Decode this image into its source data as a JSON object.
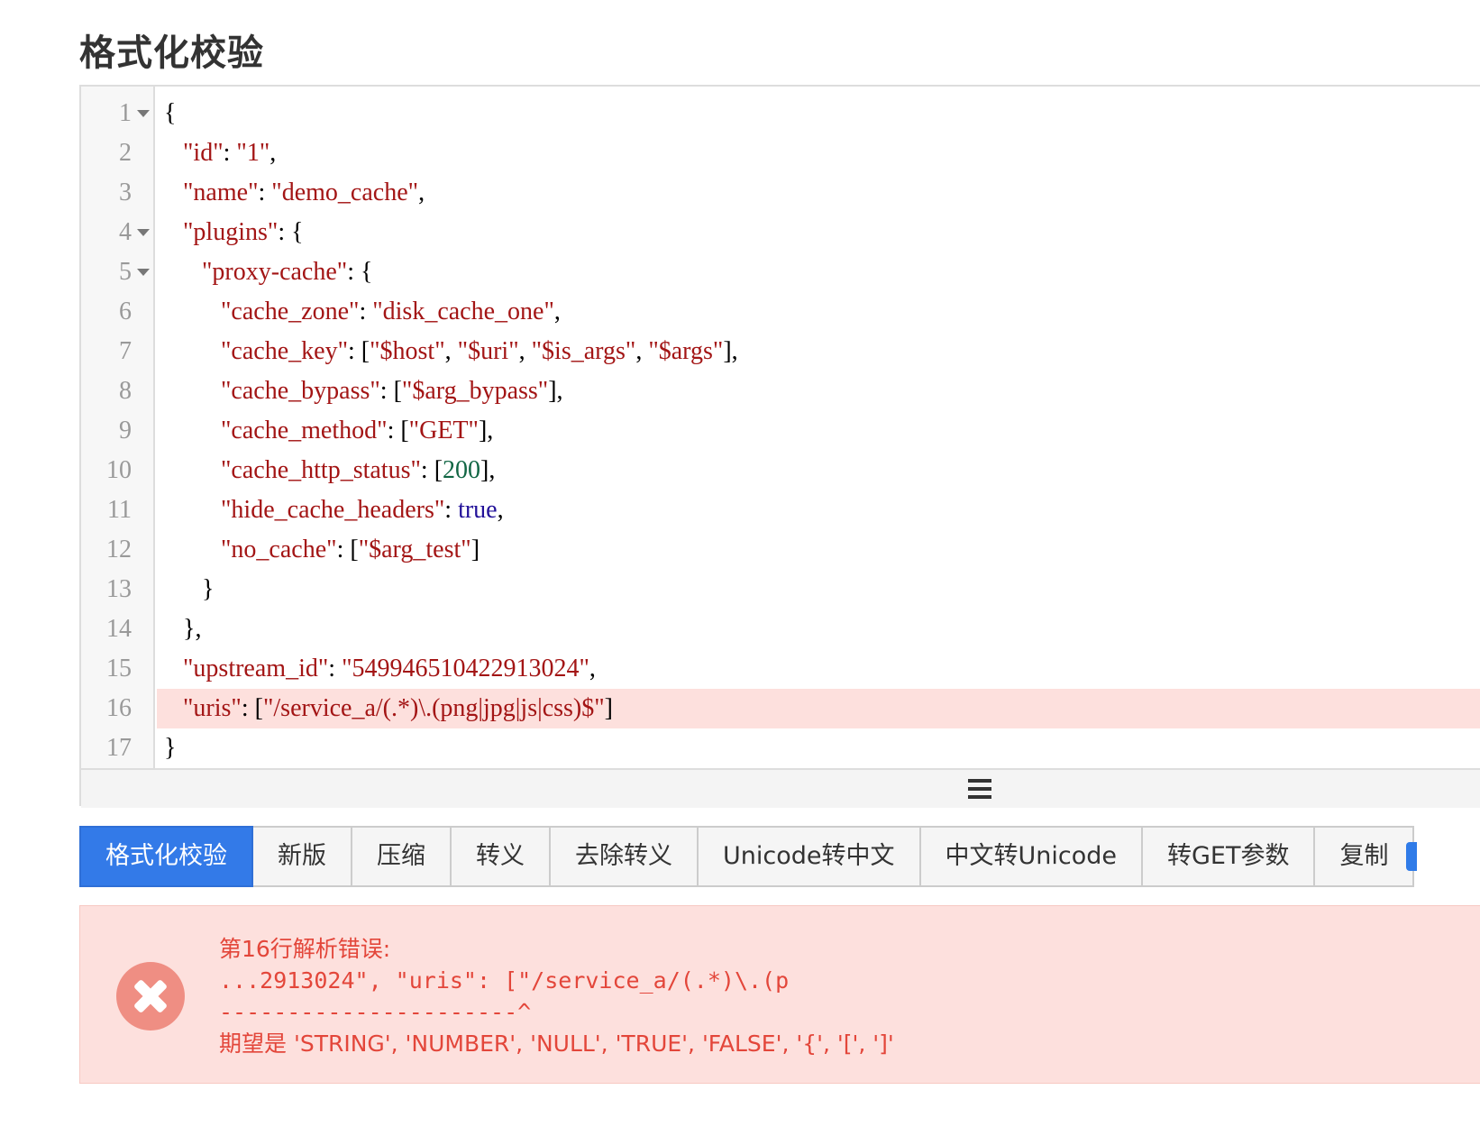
{
  "page_title": "格式化校验",
  "editor": {
    "gutter": {
      "line_numbers": [
        "1",
        "2",
        "3",
        "4",
        "5",
        "6",
        "7",
        "8",
        "9",
        "10",
        "11",
        "12",
        "13",
        "14",
        "15",
        "16",
        "17"
      ],
      "fold_lines": [
        "1",
        "4",
        "5"
      ]
    },
    "error_line": "16",
    "lines": [
      [
        {
          "t": "{",
          "c": "p"
        }
      ],
      [
        {
          "t": "   ",
          "c": "p"
        },
        {
          "t": "\"id\"",
          "c": "k"
        },
        {
          "t": ": ",
          "c": "p"
        },
        {
          "t": "\"1\"",
          "c": "s"
        },
        {
          "t": ",",
          "c": "p"
        }
      ],
      [
        {
          "t": "   ",
          "c": "p"
        },
        {
          "t": "\"name\"",
          "c": "k"
        },
        {
          "t": ": ",
          "c": "p"
        },
        {
          "t": "\"demo_cache\"",
          "c": "s"
        },
        {
          "t": ",",
          "c": "p"
        }
      ],
      [
        {
          "t": "   ",
          "c": "p"
        },
        {
          "t": "\"plugins\"",
          "c": "k"
        },
        {
          "t": ": {",
          "c": "p"
        }
      ],
      [
        {
          "t": "      ",
          "c": "p"
        },
        {
          "t": "\"proxy-cache\"",
          "c": "k"
        },
        {
          "t": ": {",
          "c": "p"
        }
      ],
      [
        {
          "t": "         ",
          "c": "p"
        },
        {
          "t": "\"cache_zone\"",
          "c": "k"
        },
        {
          "t": ": ",
          "c": "p"
        },
        {
          "t": "\"disk_cache_one\"",
          "c": "s"
        },
        {
          "t": ",",
          "c": "p"
        }
      ],
      [
        {
          "t": "         ",
          "c": "p"
        },
        {
          "t": "\"cache_key\"",
          "c": "k"
        },
        {
          "t": ": [",
          "c": "p"
        },
        {
          "t": "\"$host\"",
          "c": "s"
        },
        {
          "t": ", ",
          "c": "p"
        },
        {
          "t": "\"$uri\"",
          "c": "s"
        },
        {
          "t": ", ",
          "c": "p"
        },
        {
          "t": "\"$is_args\"",
          "c": "s"
        },
        {
          "t": ", ",
          "c": "p"
        },
        {
          "t": "\"$args\"",
          "c": "s"
        },
        {
          "t": "],",
          "c": "p"
        }
      ],
      [
        {
          "t": "         ",
          "c": "p"
        },
        {
          "t": "\"cache_bypass\"",
          "c": "k"
        },
        {
          "t": ": [",
          "c": "p"
        },
        {
          "t": "\"$arg_bypass\"",
          "c": "s"
        },
        {
          "t": "],",
          "c": "p"
        }
      ],
      [
        {
          "t": "         ",
          "c": "p"
        },
        {
          "t": "\"cache_method\"",
          "c": "k"
        },
        {
          "t": ": [",
          "c": "p"
        },
        {
          "t": "\"GET\"",
          "c": "s"
        },
        {
          "t": "],",
          "c": "p"
        }
      ],
      [
        {
          "t": "         ",
          "c": "p"
        },
        {
          "t": "\"cache_http_status\"",
          "c": "k"
        },
        {
          "t": ": [",
          "c": "p"
        },
        {
          "t": "200",
          "c": "n"
        },
        {
          "t": "],",
          "c": "p"
        }
      ],
      [
        {
          "t": "         ",
          "c": "p"
        },
        {
          "t": "\"hide_cache_headers\"",
          "c": "k"
        },
        {
          "t": ": ",
          "c": "p"
        },
        {
          "t": "true",
          "c": "b"
        },
        {
          "t": ",",
          "c": "p"
        }
      ],
      [
        {
          "t": "         ",
          "c": "p"
        },
        {
          "t": "\"no_cache\"",
          "c": "k"
        },
        {
          "t": ": [",
          "c": "p"
        },
        {
          "t": "\"$arg_test\"",
          "c": "s"
        },
        {
          "t": "]",
          "c": "p"
        }
      ],
      [
        {
          "t": "      }",
          "c": "p"
        }
      ],
      [
        {
          "t": "   },",
          "c": "p"
        }
      ],
      [
        {
          "t": "   ",
          "c": "p"
        },
        {
          "t": "\"upstream_id\"",
          "c": "k"
        },
        {
          "t": ": ",
          "c": "p"
        },
        {
          "t": "\"549946510422913024\"",
          "c": "s"
        },
        {
          "t": ",",
          "c": "p"
        }
      ],
      [
        {
          "t": "   ",
          "c": "p"
        },
        {
          "t": "\"uris\"",
          "c": "k"
        },
        {
          "t": ": [",
          "c": "p"
        },
        {
          "t": "\"/service_a/(.*)\\.(png|jpg|js|css)$\"",
          "c": "s"
        },
        {
          "t": "]",
          "c": "p"
        }
      ],
      [
        {
          "t": "}",
          "c": "p"
        }
      ]
    ]
  },
  "toolbar": {
    "buttons": [
      {
        "label": "格式化校验",
        "primary": true
      },
      {
        "label": "新版",
        "primary": false
      },
      {
        "label": "压缩",
        "primary": false
      },
      {
        "label": "转义",
        "primary": false
      },
      {
        "label": "去除转义",
        "primary": false
      },
      {
        "label": "Unicode转中文",
        "primary": false
      },
      {
        "label": "中文转Unicode",
        "primary": false
      },
      {
        "label": "转GET参数",
        "primary": false
      },
      {
        "label": "复制",
        "primary": false
      }
    ]
  },
  "error": {
    "title": "第16行解析错误:",
    "snippet": "...2913024\", \"uris\": [\"/service_a/(.*)\\.(p",
    "pointer": "----------------------^",
    "expected": "期望是 'STRING', 'NUMBER', 'NULL', 'TRUE', 'FALSE', '{', '[', ']'"
  },
  "colors": {
    "primary": "#337ae8",
    "error_text": "#e3463a",
    "error_bg": "#fde0dd",
    "error_icon": "#ef8e83",
    "json_key": "#a31515",
    "json_number": "#116644",
    "json_bool": "#221199"
  }
}
